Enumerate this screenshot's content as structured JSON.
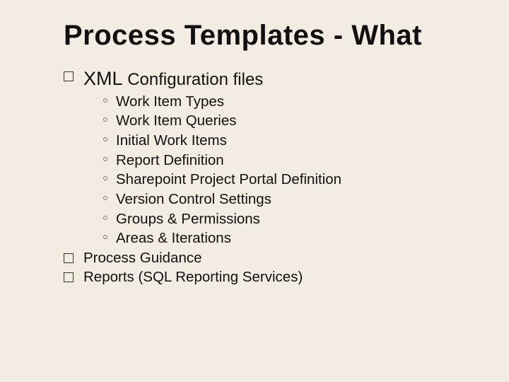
{
  "title": "Process Templates - What",
  "items": {
    "top0": {
      "prefix": "XML",
      "rest": " Configuration files"
    },
    "sub": [
      "Work Item Types",
      "Work Item Queries",
      "Initial Work Items",
      "Report Definition",
      "Sharepoint Project Portal Definition",
      "Version Control Settings",
      "Groups & Permissions",
      "Areas & Iterations"
    ],
    "top1": "Process Guidance",
    "top2": "Reports (SQL Reporting Services)"
  }
}
